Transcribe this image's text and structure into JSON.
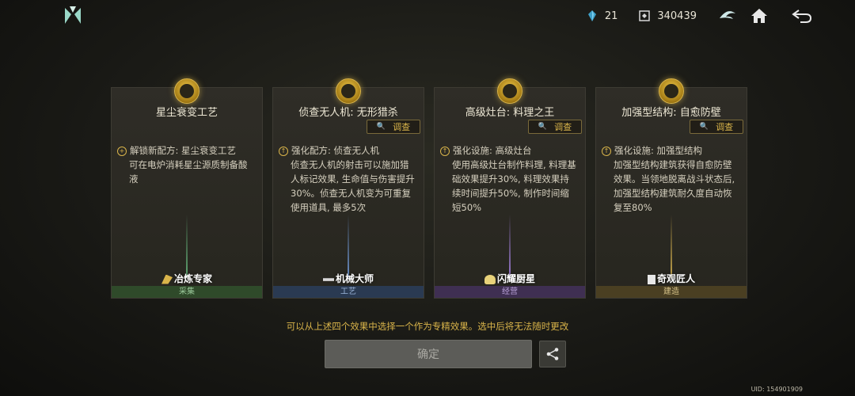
{
  "header": {
    "resource_a": "21",
    "resource_b": "340439",
    "icons": [
      "logo-icon",
      "crystal-icon",
      "currency-icon",
      "emblem-icon",
      "home-icon",
      "back-icon"
    ]
  },
  "cards": [
    {
      "title": "星尘衰变工艺",
      "has_inspect": false,
      "inspect_label": "",
      "desc_head": "解锁新配方: 星尘衰变工艺",
      "desc_body": "可在电炉消耗星尘源质制备酸液",
      "badge": "冶炼专家",
      "category": "采集",
      "cat_color": "#2f4a2a",
      "glow_color": "#5fa873"
    },
    {
      "title": "侦查无人机: 无形猎杀",
      "has_inspect": true,
      "inspect_label": "调查",
      "desc_head": "强化配方: 侦查无人机",
      "desc_body": "侦查无人机的射击可以施加猎人标记效果, 生命值与伤害提升30%。侦查无人机变为可重复使用道具, 最多5次",
      "badge": "机械大师",
      "category": "工艺",
      "cat_color": "#2a3a52",
      "glow_color": "#6a8fc7"
    },
    {
      "title": "高级灶台: 料理之王",
      "has_inspect": true,
      "inspect_label": "调查",
      "desc_head": "强化设施: 高级灶台",
      "desc_body": "使用高级灶台制作料理, 料理基础效果提升30%, 料理效果持续时间提升50%, 制作时间缩短50%",
      "badge": "闪耀厨星",
      "category": "经营",
      "cat_color": "#3f2f52",
      "glow_color": "#9a7ad0"
    },
    {
      "title": "加强型结构: 自愈防壁",
      "has_inspect": true,
      "inspect_label": "调查",
      "desc_head": "强化设施: 加强型结构",
      "desc_body": "加强型结构建筑获得自愈防壁效果。当领地脱离战斗状态后, 加强型结构建筑耐久度自动恢复至80%",
      "badge": "奇观匠人",
      "category": "建造",
      "cat_color": "#4a3f22",
      "glow_color": "#c7a64a"
    }
  ],
  "footer": {
    "note": "可以从上述四个效果中选择一个作为专精效果。选中后将无法随时更改",
    "confirm_label": "确定",
    "uid": "UID: 154901909"
  }
}
